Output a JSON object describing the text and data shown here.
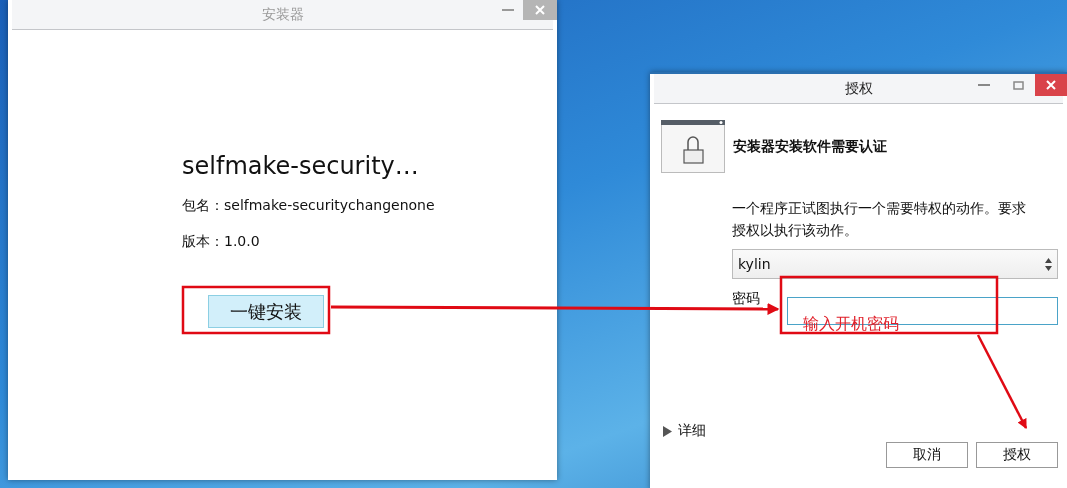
{
  "installer_window": {
    "title": "安装器",
    "package_title": "selfmake-security…",
    "package_name": "包名：selfmake-securitychangenone",
    "version": "版本：1.0.0",
    "install_button": "一键安装"
  },
  "auth_dialog": {
    "title": "授权",
    "heading": "安装器安装软件需要认证",
    "message": "一个程序正试图执行一个需要特权的动作。要求授权以执行该动作。",
    "user_select": "kylin",
    "password_label": "密码",
    "details": {
      "label": "详细",
      "expanded": false
    },
    "buttons": [
      "取消",
      "授权"
    ]
  },
  "annotation": {
    "note": "输入开机密码"
  }
}
